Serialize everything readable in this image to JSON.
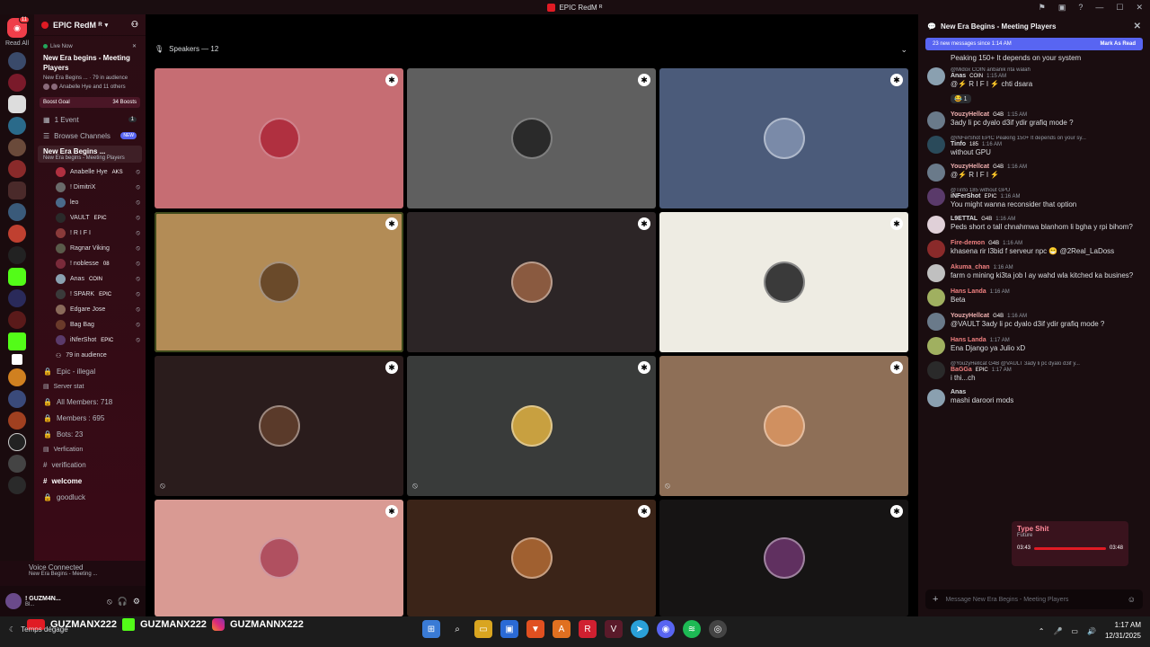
{
  "titlebar": {
    "title": "EPIC RedM ᴿ"
  },
  "rail": {
    "dm_badge": "11",
    "read_all": "Read All"
  },
  "server": {
    "name": "EPIC RedM ᴿ"
  },
  "live": {
    "tag": "Live Now",
    "title": "New Era begins - Meeting Players",
    "meta": "New Era Begins ... · 79 in audience",
    "people": "Anabelle Hye and 11 others"
  },
  "boost": {
    "label": "Boost Goal",
    "count": "34 Boosts"
  },
  "channels": {
    "event": "1 Event",
    "event_count": "1",
    "browse": "Browse Channels",
    "new_badge": "NEW",
    "voice_title": "New Era Begins ...",
    "voice_sub": "New Era begins - Meeting Players",
    "audience": "79 in audience",
    "illegal": "Epic - illegal",
    "server_stat": "Server stat",
    "all_members": "All Members: 718",
    "members": "Members : 695",
    "bots": "Bots: 23",
    "verification_cat": "Verfication",
    "verification": "verification",
    "welcome": "welcome",
    "goodluck": "goodluck"
  },
  "voice_users": [
    {
      "name": "Anabelle Hye",
      "tag": "AKS"
    },
    {
      "name": "! DimitriX"
    },
    {
      "name": "leo"
    },
    {
      "name": "VAULT",
      "tag": "EPIC"
    },
    {
      "name": "! R I F I"
    },
    {
      "name": "Ragnar Viking"
    },
    {
      "name": "! noblesse",
      "tag": "08"
    },
    {
      "name": "Anas",
      "tag": "COIN"
    },
    {
      "name": "! SPARK",
      "tag": "EPIC"
    },
    {
      "name": "Edgare Jose"
    },
    {
      "name": "Bag Bag"
    },
    {
      "name": "iNferShot",
      "tag": "EPIC"
    }
  ],
  "voice_connected": {
    "label": "Voice Connected",
    "sub": "New Era Begins - Meeting ..."
  },
  "user": {
    "name": "! GUZM4N...",
    "status": "Bl..."
  },
  "stage": {
    "speakers": "Speakers — 12"
  },
  "tiles": [
    {
      "bg": "#c66d73",
      "av": "#b03040"
    },
    {
      "bg": "#5f5f5f",
      "av": "#2a2a2a"
    },
    {
      "bg": "#4b5b7a",
      "av": "#7a8aa8"
    },
    {
      "bg": "#b38c56",
      "av": "#6a4a2a"
    },
    {
      "bg": "#2c2526",
      "av": "#8a5a40"
    },
    {
      "bg": "#eeece3",
      "av": "#3a3a3a"
    },
    {
      "bg": "#2a1c1c",
      "av": "#5a3a2a"
    },
    {
      "bg": "#393b3a",
      "av": "#c8a040"
    },
    {
      "bg": "#8e6f57",
      "av": "#d09060"
    },
    {
      "bg": "#d99a93",
      "av": "#b05060"
    },
    {
      "bg": "#3b2418",
      "av": "#a06030"
    },
    {
      "bg": "#161414",
      "av": "#603060"
    }
  ],
  "chat": {
    "title": "New Era Begins - Meeting Players",
    "new_messages": "23 new messages since 1:14 AM",
    "mark_read": "Mark As Read",
    "input_placeholder": "Message New Era Begins - Meeting Players",
    "first_line": "Peaking 150+ It depends on your system",
    "messages": [
      {
        "reply": "@Midox COIN anbanik nta walah",
        "name": "Anas",
        "color": "#dbdee1",
        "tag": "COIN",
        "time": "1:15 AM",
        "text": "@⚡ R I F I ⚡ chti dsara",
        "reaction": "😂 1",
        "av": "#8aa0b0"
      },
      {
        "name": "YouzyHellcat",
        "color": "#f0b0b0",
        "tag": "G4B",
        "time": "1:15 AM",
        "text": "3ady li pc dyalo d3if ydir grafiq mode ?",
        "av": "#6a7a8a"
      },
      {
        "reply": "@iNFerShot EPIC Peaking 150+ It depends on your sy...",
        "name": "Tinfo",
        "color": "#dbdee1",
        "tag": "185",
        "time": "1:16 AM",
        "text": "without GPU",
        "av": "#2a4a5a"
      },
      {
        "name": "YouzyHellcat",
        "color": "#f0b0b0",
        "tag": "G4B",
        "time": "1:16 AM",
        "text": "@⚡ R I F I ⚡",
        "av": "#6a7a8a"
      },
      {
        "reply": "@Tinfo 185 without GPU",
        "name": "iNFerShot",
        "color": "#dbdee1",
        "tag": "EPIC",
        "time": "1:16 AM",
        "text": "You might wanna reconsider that option",
        "av": "#5a3a6a"
      },
      {
        "name": "L9ETTAL",
        "color": "#dbdee1",
        "tag": "G4B",
        "time": "1:16 AM",
        "text": "Peds short o tall chnahmwa blanhom li bgha y rpi bihom?",
        "av": "#e0d0d8"
      },
      {
        "name": "Fire-demon",
        "color": "#f08080",
        "tag": "G4B",
        "time": "1:16 AM",
        "text": "khasena rir l3bid f serveur npc 😁 @2Real_LaDoss",
        "av": "#8a2a2a"
      },
      {
        "name": "Akuma_chan",
        "color": "#f08080",
        "tag": "",
        "time": "1:16 AM",
        "text": "farm o mining ki3ta job l ay wahd wla kitched ka busines?",
        "av": "#c0c0c0"
      },
      {
        "name": "Hans Landa",
        "color": "#f08080",
        "tag": "",
        "time": "1:16 AM",
        "text": "Beta",
        "av": "#a0b060"
      },
      {
        "name": "YouzyHellcat",
        "color": "#f0b0b0",
        "tag": "G4B",
        "time": "1:16 AM",
        "text": "@VAULT 3ady li pc dyalo d3if ydir grafiq mode ?",
        "av": "#6a7a8a"
      },
      {
        "name": "Hans Landa",
        "color": "#f08080",
        "tag": "",
        "time": "1:17 AM",
        "text": "Ena Django ya Julio xD",
        "av": "#a0b060"
      },
      {
        "reply": "@YouzyHellcat G4B @VAULT 3ady li pc dyalo d3if y...",
        "name": "BaGGa",
        "color": "#f08080",
        "tag": "EPIC",
        "time": "1:17 AM",
        "text": "i thi...ch",
        "av": "#2a2a2a"
      },
      {
        "name": "Anas",
        "color": "#dbdee1",
        "tag": "",
        "time": "",
        "text": "mashi daroori mods",
        "av": "#8aa0b0"
      }
    ]
  },
  "music": {
    "title": "Type Shit",
    "artist": "Future",
    "elapsed": "03:43",
    "total": "03:48"
  },
  "overlay": {
    "yt": "GUZMANX222",
    "kick": "GUZMANX222",
    "ig": "GUZMANNX222"
  },
  "taskbar": {
    "weather": "Temps dégagé",
    "time": "1:17 AM",
    "date": "12/31/2025"
  }
}
